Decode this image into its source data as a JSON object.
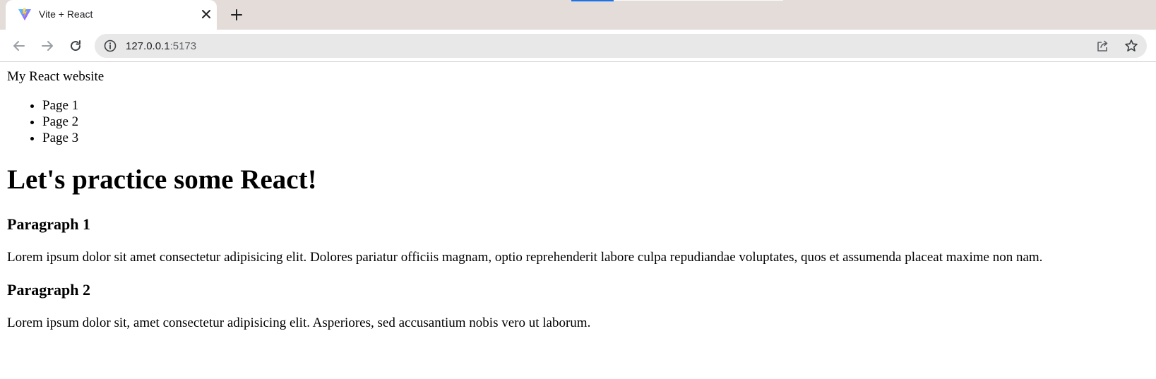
{
  "browser": {
    "tab": {
      "title": "Vite + React",
      "favicon": "vite-logo-icon"
    },
    "new_tab_icon": "plus-icon",
    "address_bar": {
      "host": "127.0.0.1",
      "port": ":5173"
    },
    "icons": {
      "back": "arrow-left-icon",
      "forward": "arrow-right-icon",
      "reload": "reload-icon",
      "site_info": "info-icon",
      "share": "share-icon",
      "bookmark": "star-icon"
    }
  },
  "page": {
    "site_name": "My React website",
    "nav_items": [
      "Page 1",
      "Page 2",
      "Page 3"
    ],
    "title": "Let's practice some React!",
    "sections": [
      {
        "heading": "Paragraph 1",
        "text": "Lorem ipsum dolor sit amet consectetur adipisicing elit. Dolores pariatur officiis magnam, optio reprehenderit labore culpa repudiandae voluptates, quos et assumenda placeat maxime non nam."
      },
      {
        "heading": "Paragraph 2",
        "text": "Lorem ipsum dolor sit, amet consectetur adipisicing elit. Asperiores, sed accusantium nobis vero ut laborum."
      }
    ]
  }
}
